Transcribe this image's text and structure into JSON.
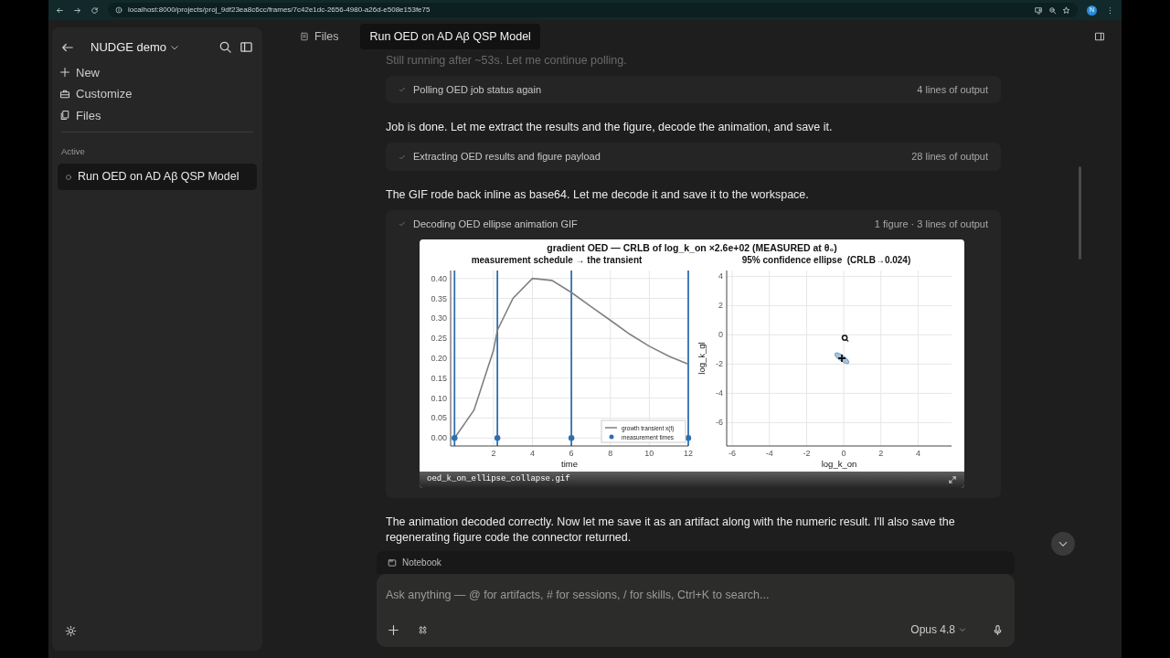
{
  "browser": {
    "url": "localhost:8000/projects/proj_9df23ea8c6cc/frames/7c42e1dc-2656-4980-a26d-e508e153fe75",
    "profile_initial": "N"
  },
  "sidebar": {
    "workspace": "NUDGE demo",
    "actions": [
      {
        "label": "New",
        "kind": "new"
      },
      {
        "label": "Customize",
        "kind": "customize"
      },
      {
        "label": "Files",
        "kind": "files"
      }
    ],
    "section": "Active",
    "sessions": [
      {
        "title": "Run OED on AD Aβ QSP Model",
        "selected": true
      }
    ]
  },
  "tabs": [
    {
      "label": "Files",
      "selected": false,
      "kind": "files"
    },
    {
      "label": "Run OED on AD Aβ QSP Model",
      "selected": true,
      "kind": "session"
    }
  ],
  "messages": [
    {
      "kind": "text",
      "text": "Still running after ~53s. Let me continue polling.",
      "faded": true
    },
    {
      "kind": "tool",
      "label": "Polling OED job status again",
      "summary": "4 lines of output"
    },
    {
      "kind": "text",
      "text": "Job is done. Let me extract the results and the figure, decode the animation, and save it.",
      "faded": false
    },
    {
      "kind": "tool",
      "label": "Extracting OED results and figure payload",
      "summary": "28 lines of output"
    },
    {
      "kind": "text",
      "text": "The GIF rode back inline as base64. Let me decode it and save it to the workspace.",
      "faded": false
    },
    {
      "kind": "tool",
      "label": "Decoding OED ellipse animation GIF",
      "summary": "1 figure · 3 lines of output",
      "figure": {
        "title": "gradient OED — CRLB of log_k_on ×2.6e+02 (MEASURED at θ₀)",
        "filename": "oed_k_on_ellipse_collapse.gif",
        "panels": [
          {
            "chart_data": {
              "type": "line",
              "title": "measurement schedule → the transient",
              "xlabel": "time",
              "x": [
                0,
                1,
                2,
                2.2,
                3,
                4,
                5,
                6,
                7,
                8,
                9,
                10,
                11,
                12
              ],
              "series": [
                {
                  "name": "growth transient x(t)",
                  "color": "#808080",
                  "values": [
                    0,
                    0.07,
                    0.22,
                    0.27,
                    0.35,
                    0.4,
                    0.395,
                    0.365,
                    0.33,
                    0.295,
                    0.26,
                    0.23,
                    0.205,
                    0.185
                  ]
                },
                {
                  "name": "measurement times",
                  "color": "#2f6fb0",
                  "marker": "o",
                  "values": [
                    0,
                    null,
                    null,
                    0,
                    null,
                    null,
                    null,
                    0,
                    null,
                    null,
                    null,
                    null,
                    null,
                    0
                  ]
                }
              ],
              "ref_lines": [
                {
                  "axis": "x",
                  "value": 0,
                  "color": "#2f6fb0"
                },
                {
                  "axis": "x",
                  "value": 2.2,
                  "color": "#2f6fb0"
                },
                {
                  "axis": "x",
                  "value": 6,
                  "color": "#2f6fb0"
                },
                {
                  "axis": "x",
                  "value": 12,
                  "color": "#2f6fb0"
                }
              ],
              "grid": true,
              "xlim": [
                -0.2,
                12
              ],
              "ylim": [
                -0.02,
                0.42
              ],
              "xticks": [
                2,
                4,
                6,
                8,
                10,
                12
              ],
              "yticks": [
                {
                  "value": 0,
                  "label": "0.00"
                },
                0.05,
                {
                  "value": 0.1,
                  "label": "0.10"
                },
                0.15,
                {
                  "value": 0.2,
                  "label": "0.20"
                },
                0.25,
                {
                  "value": 0.3,
                  "label": "0.30"
                },
                0.35,
                {
                  "value": 0.4,
                  "label": "0.40"
                }
              ]
            }
          },
          {
            "chart_data": {
              "type": "scatter",
              "title": "95% confidence ellipse  (CRLB→0.024)",
              "xlabel": "log_k_on",
              "ylabel": "log_k_gl",
              "x": [
                0.05,
                -0.1
              ],
              "values": [
                -0.2,
                -1.6
              ],
              "grid": true,
              "xlim": [
                -6.3,
                5.8
              ],
              "ylim": [
                -7.6,
                4.4
              ],
              "xticks": [
                -6,
                -4,
                -2,
                0,
                2,
                4
              ],
              "yticks": [
                -6,
                -4,
                -2,
                0,
                2,
                4
              ]
            }
          }
        ]
      }
    },
    {
      "kind": "text",
      "text": "The animation decoded correctly. Now let me save it as an artifact along with the numeric result. I'll also save the regenerating figure code the connector returned.",
      "faded": false
    }
  ],
  "composer": {
    "context": "Notebook",
    "placeholder": "Ask anything — @ for artifacts, # for sessions, / for skills, Ctrl+K to search...",
    "model": "Opus 4.8"
  }
}
